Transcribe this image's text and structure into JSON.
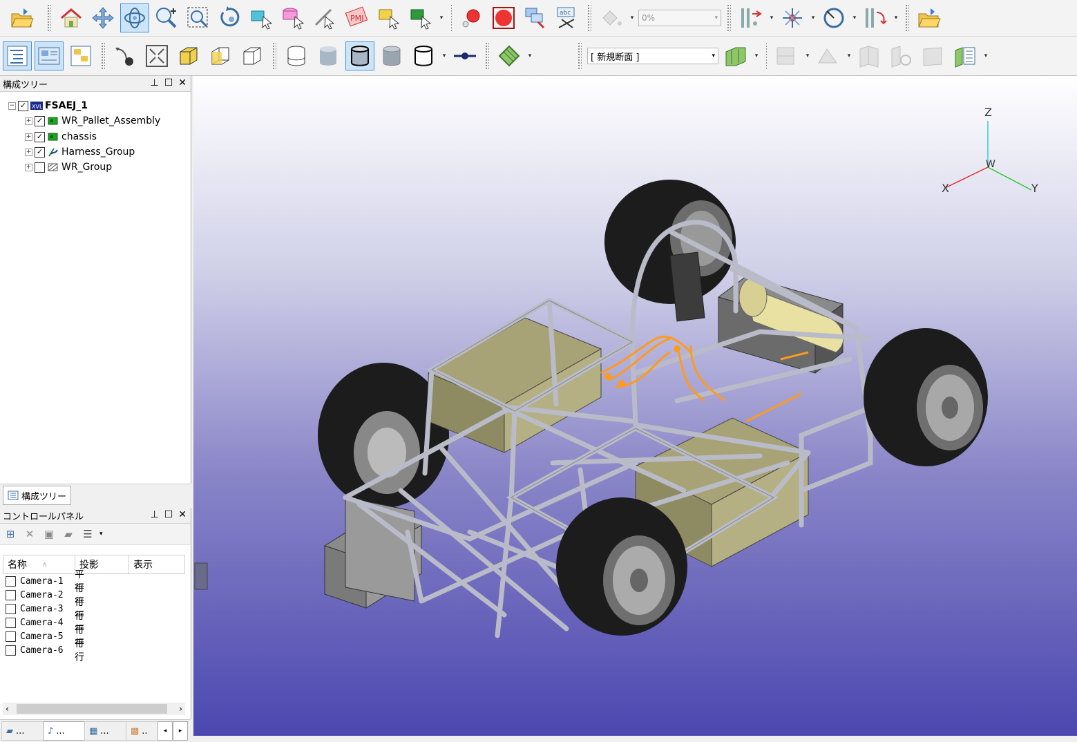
{
  "toolbar": {
    "transparency_value": "0%",
    "section_select": "[ 新規断面 ]"
  },
  "tree_pane": {
    "title": "構成ツリー",
    "items": [
      {
        "label": "FSAEJ_1",
        "checked": true,
        "icon": "xvl-file-icon"
      },
      {
        "label": "WR_Pallet_Assembly",
        "checked": true,
        "icon": "assembly-icon"
      },
      {
        "label": "chassis",
        "checked": true,
        "icon": "assembly-icon"
      },
      {
        "label": "Harness_Group",
        "checked": true,
        "icon": "harness-icon"
      },
      {
        "label": "WR_Group",
        "checked": false,
        "icon": "group-icon"
      }
    ],
    "tab_label": "構成ツリー"
  },
  "control_panel": {
    "title": "コントロールパネル",
    "columns": [
      "名称",
      "投影",
      "表示"
    ],
    "cameras": [
      {
        "name": "Camera-1",
        "projection": "平行"
      },
      {
        "name": "Camera-2",
        "projection": "平行"
      },
      {
        "name": "Camera-3",
        "projection": "平行"
      },
      {
        "name": "Camera-4",
        "projection": "平行"
      },
      {
        "name": "Camera-5",
        "projection": "平行"
      },
      {
        "name": "Camera-6",
        "projection": "平行"
      }
    ],
    "bottom_tabs": [
      "...",
      "...",
      "...",
      ".."
    ]
  },
  "viewport": {
    "axis_labels": {
      "z": "Z",
      "x": "X",
      "y": "Y",
      "w": "W"
    },
    "model_colors": {
      "frame": "#b9bcc8",
      "tire": "#1e1e1e",
      "battery": "#b8b482",
      "harness": "#ff9a1e"
    }
  }
}
